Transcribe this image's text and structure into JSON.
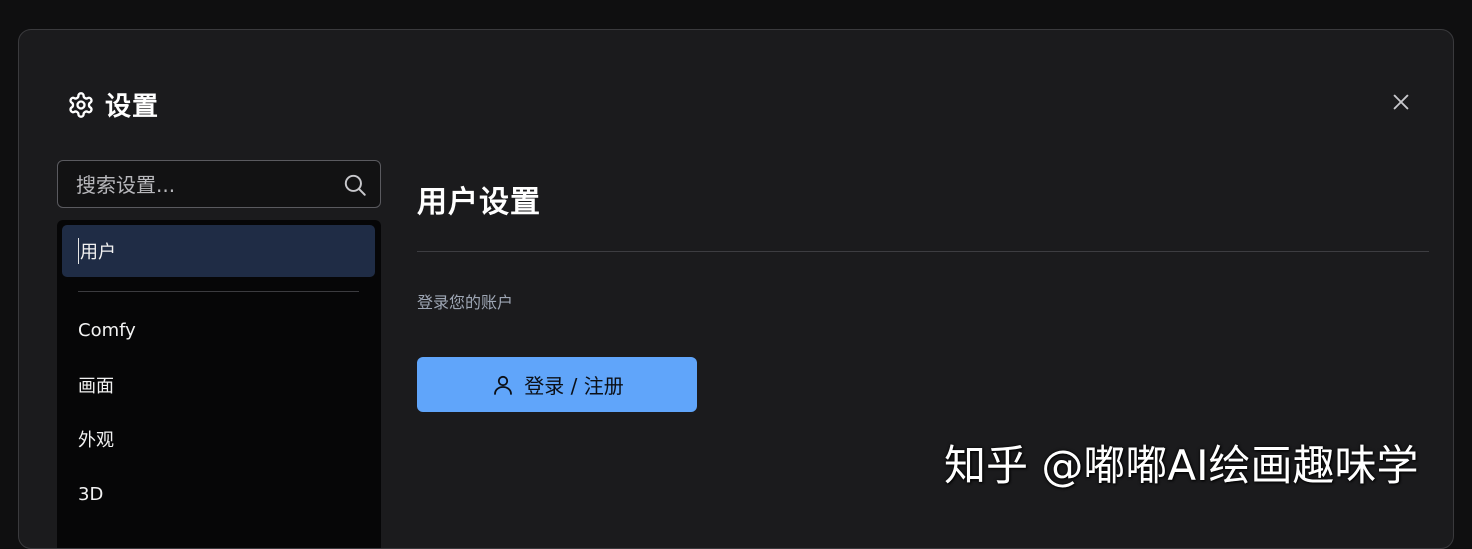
{
  "dialog": {
    "title": "设置",
    "title_icon": "gear-icon",
    "close_icon": "close-icon"
  },
  "search": {
    "placeholder": "搜索设置...",
    "value": "",
    "icon": "search-icon"
  },
  "sidebar": {
    "items": [
      {
        "label": "用户",
        "active": true
      },
      {
        "label": "Comfy",
        "active": false
      },
      {
        "label": "画面",
        "active": false
      },
      {
        "label": "外观",
        "active": false
      },
      {
        "label": "3D",
        "active": false
      }
    ]
  },
  "main": {
    "title": "用户设置",
    "login_hint": "登录您的账户",
    "login_button": {
      "label": "登录 / 注册",
      "icon": "user-icon"
    }
  },
  "watermark": "知乎 @嘟嘟AI绘画趣味学",
  "colors": {
    "accent": "#60a5fa",
    "active_item_bg": "#1f2c45",
    "dialog_bg": "#1b1b1d",
    "sidebar_bg": "#060607"
  }
}
